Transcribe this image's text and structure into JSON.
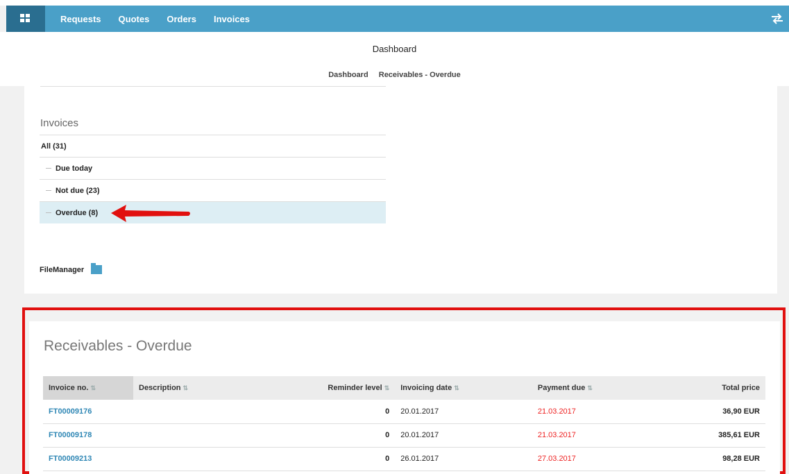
{
  "nav": {
    "items": [
      "Requests",
      "Quotes",
      "Orders",
      "Invoices"
    ]
  },
  "header": {
    "title": "Dashboard",
    "breadcrumb": [
      "Dashboard",
      "Receivables - Overdue"
    ]
  },
  "invoices": {
    "title": "Invoices",
    "items": [
      {
        "label": "All (31)"
      },
      {
        "label": "Due today"
      },
      {
        "label": "Not due (23)"
      },
      {
        "label": "Overdue (8)"
      }
    ],
    "filemanager": "FileManager"
  },
  "receivables": {
    "title": "Receivables - Overdue",
    "columns": [
      "Invoice no.",
      "Description",
      "Reminder level",
      "Invoicing date",
      "Payment due",
      "Total price"
    ],
    "rows": [
      {
        "invoice": "FT00009176",
        "description": "",
        "reminder": "0",
        "invoicing_date": "20.01.2017",
        "payment_due": "21.03.2017",
        "total": "36,90 EUR"
      },
      {
        "invoice": "FT00009178",
        "description": "",
        "reminder": "0",
        "invoicing_date": "20.01.2017",
        "payment_due": "21.03.2017",
        "total": "385,61 EUR"
      },
      {
        "invoice": "FT00009213",
        "description": "",
        "reminder": "0",
        "invoicing_date": "26.01.2017",
        "payment_due": "27.03.2017",
        "total": "98,28 EUR"
      }
    ]
  },
  "colors": {
    "nav": "#4aa0c8",
    "nav_home": "#2a6e90",
    "link": "#2f87b5",
    "overdue": "#e22222",
    "highlight_frame": "#e1100f"
  }
}
